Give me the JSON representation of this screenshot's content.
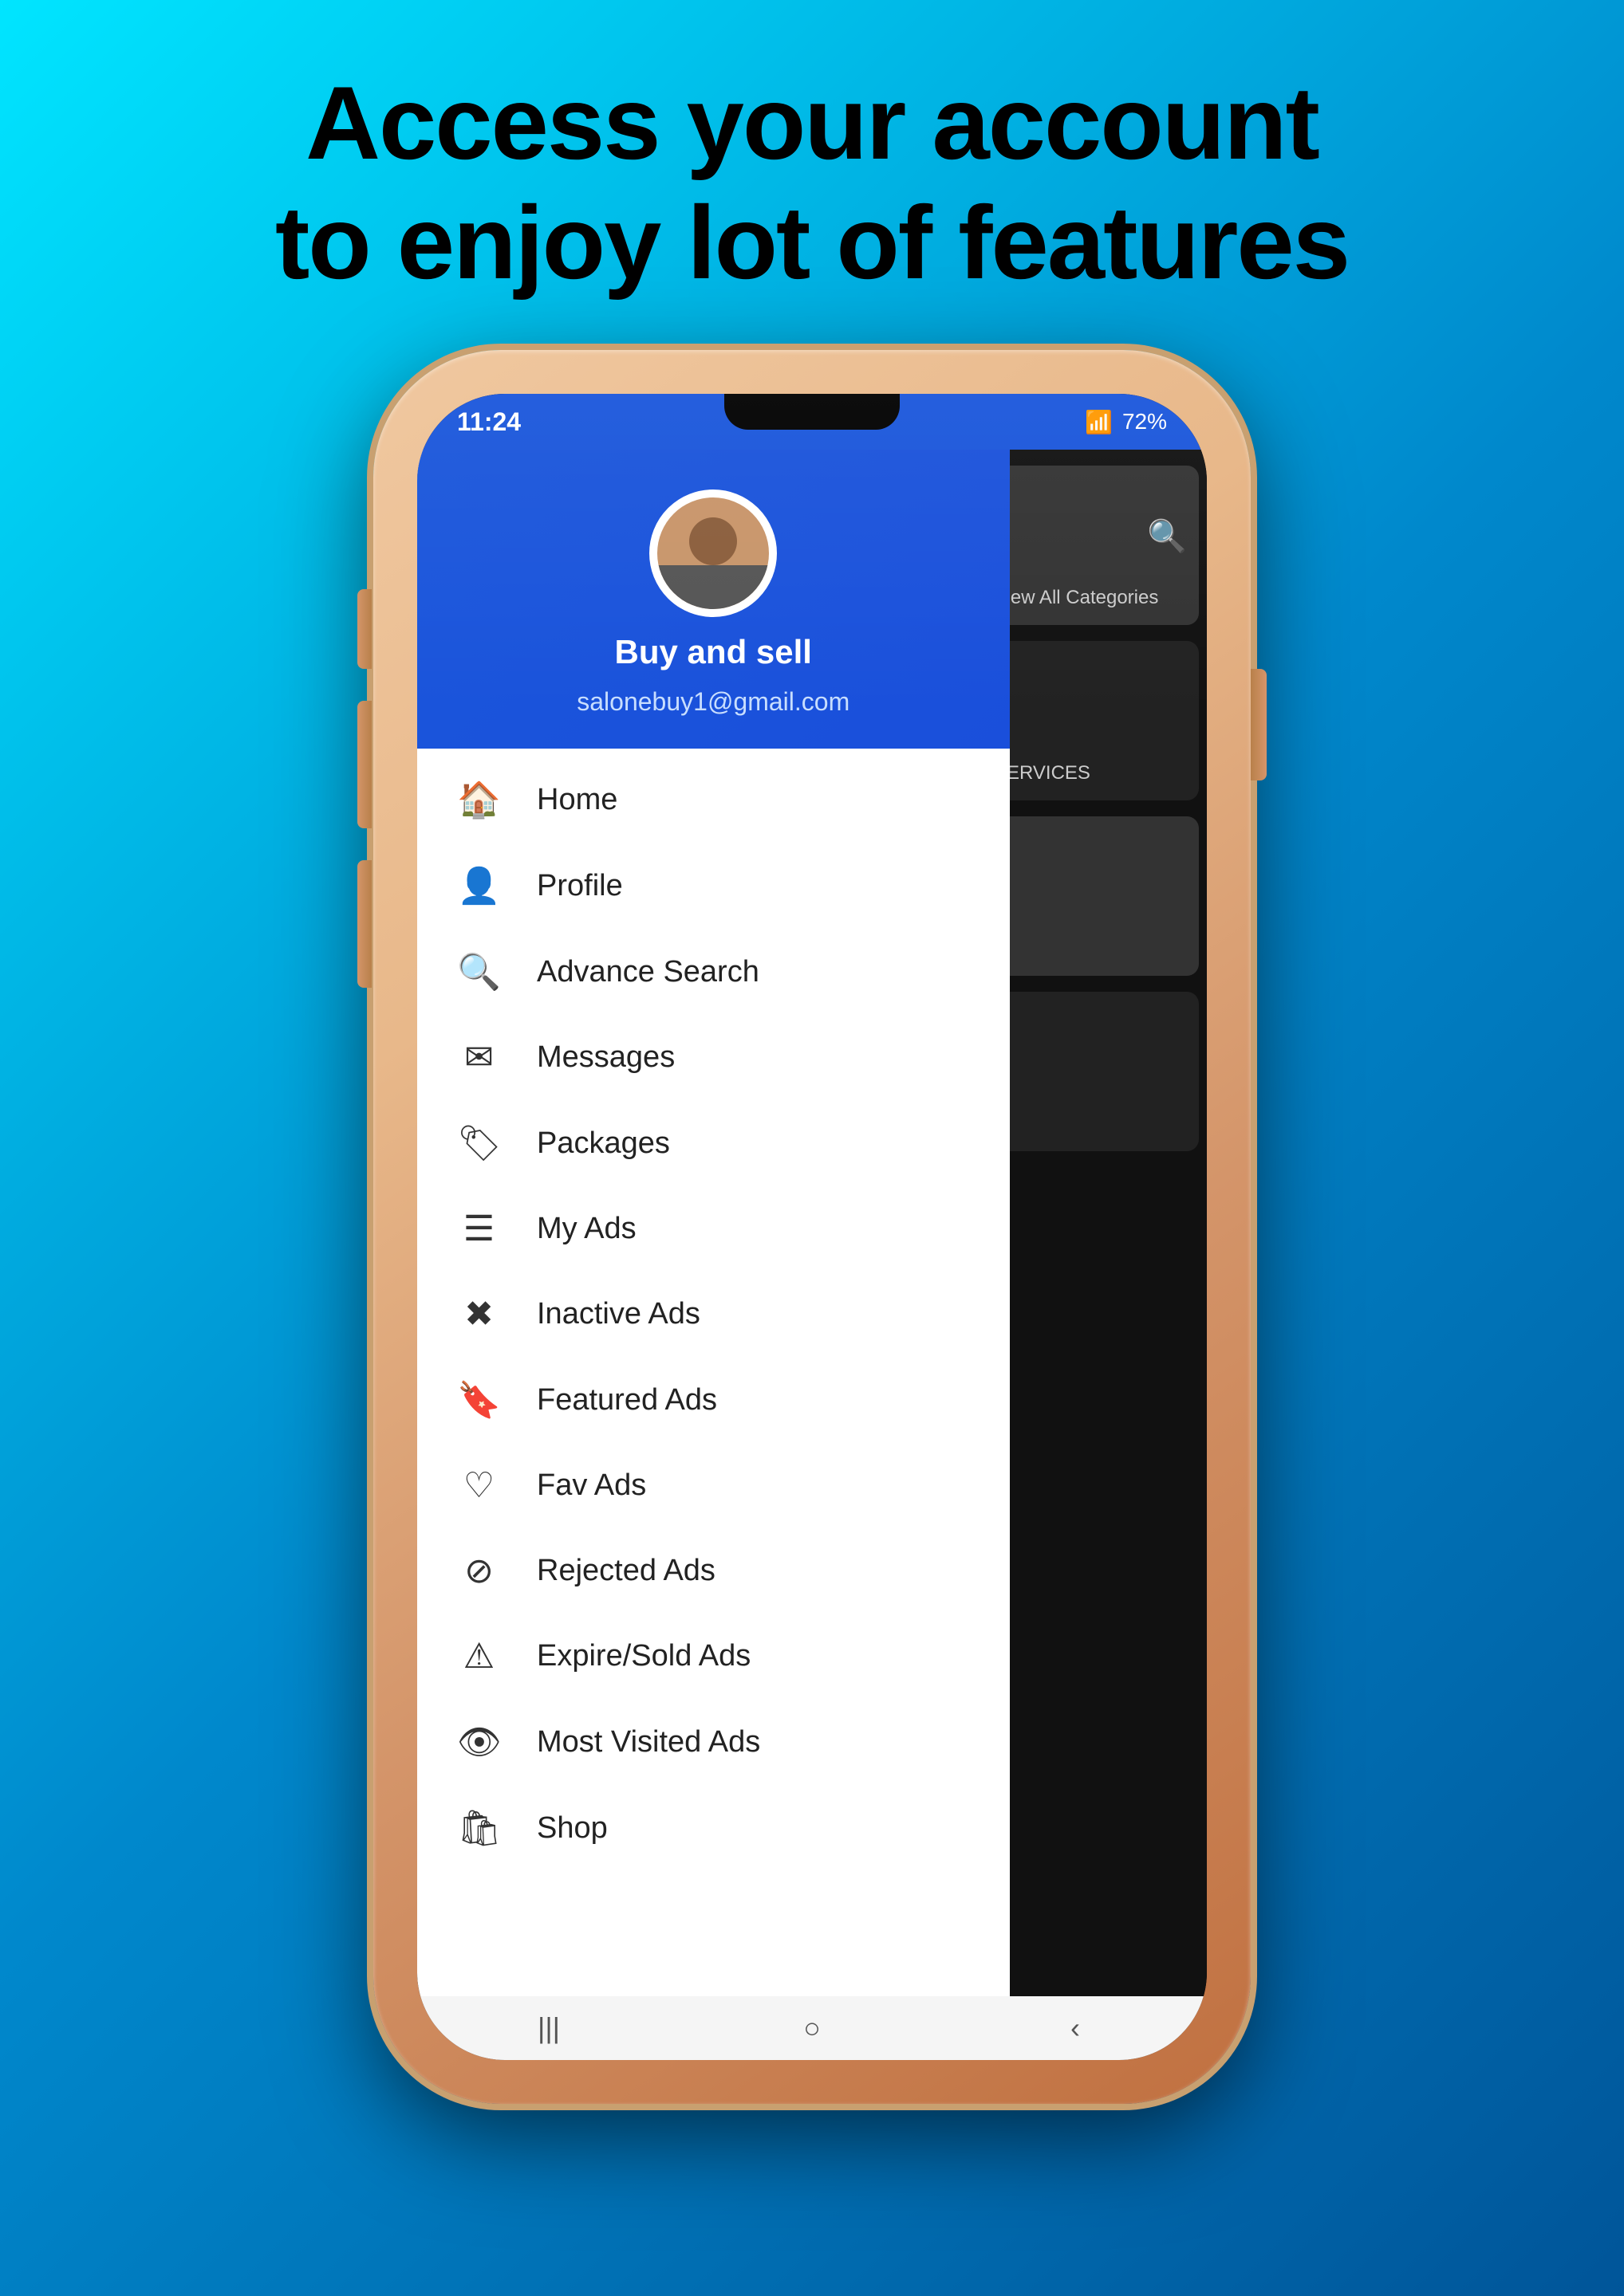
{
  "headline": {
    "line1": "Access your account",
    "line2": "to enjoy lot of features"
  },
  "status_bar": {
    "time": "11:24",
    "battery": "72%",
    "icons": "📶"
  },
  "drawer": {
    "user_name": "Buy and sell",
    "user_email": "salonebuy1@gmail.com",
    "menu_items": [
      {
        "id": "home",
        "icon": "⌂",
        "label": "Home"
      },
      {
        "id": "profile",
        "icon": "👤",
        "label": "Profile"
      },
      {
        "id": "advance-search",
        "icon": "🔍",
        "label": "Advance Search"
      },
      {
        "id": "messages",
        "icon": "✉",
        "label": "Messages"
      },
      {
        "id": "packages",
        "icon": "🏷",
        "label": "Packages"
      },
      {
        "id": "my-ads",
        "icon": "≡",
        "label": "My Ads"
      },
      {
        "id": "inactive-ads",
        "icon": "✗",
        "label": "Inactive Ads"
      },
      {
        "id": "featured-ads",
        "icon": "🔖",
        "label": "Featured Ads"
      },
      {
        "id": "fav-ads",
        "icon": "♡",
        "label": "Fav Ads"
      },
      {
        "id": "rejected-ads",
        "icon": "⊘",
        "label": "Rejected Ads"
      },
      {
        "id": "expire-sold-ads",
        "icon": "⚠",
        "label": "Expire/Sold Ads"
      },
      {
        "id": "most-visited-ads",
        "icon": "👁",
        "label": "Most Visited Ads"
      },
      {
        "id": "shop",
        "icon": "🛍",
        "label": "Shop"
      }
    ]
  },
  "bottom_nav": {
    "recent": "|||",
    "home": "○",
    "back": "‹"
  },
  "bg_content": {
    "view_all_categories": "View All Categories",
    "services": "SERVICES"
  }
}
